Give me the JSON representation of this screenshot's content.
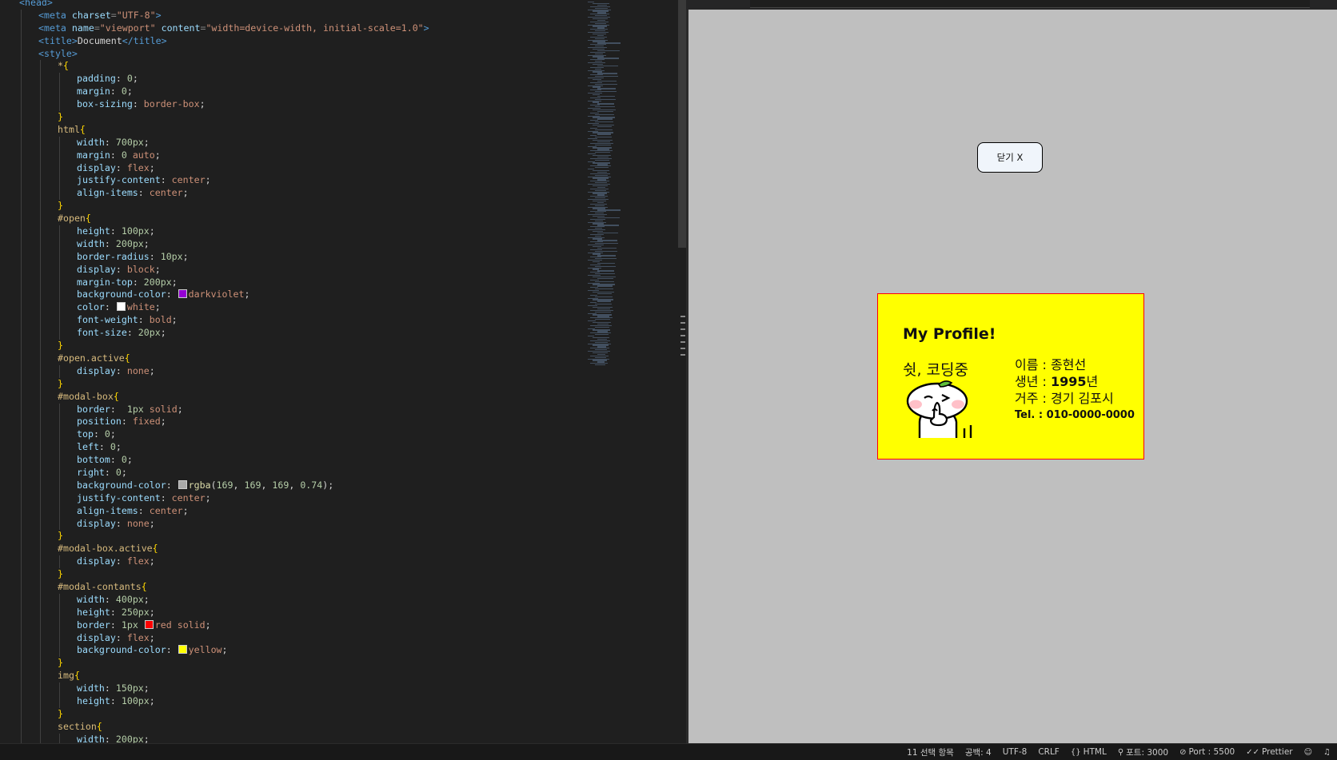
{
  "editor": {
    "lines": [
      {
        "indent": 0,
        "tokens": [
          [
            "tag",
            "<head>"
          ]
        ]
      },
      {
        "indent": 1,
        "tokens": [
          [
            "tag",
            "<meta "
          ],
          [
            "attr",
            "charset"
          ],
          [
            "punct",
            "="
          ],
          [
            "str",
            "\"UTF-8\""
          ],
          [
            "tag",
            ">"
          ]
        ]
      },
      {
        "indent": 1,
        "tokens": [
          [
            "tag",
            "<meta "
          ],
          [
            "attr",
            "name"
          ],
          [
            "punct",
            "="
          ],
          [
            "str",
            "\"viewport\""
          ],
          [
            "attr",
            " content"
          ],
          [
            "punct",
            "="
          ],
          [
            "str",
            "\"width=device-width, initial-scale=1.0\""
          ],
          [
            "tag",
            ">"
          ]
        ]
      },
      {
        "indent": 1,
        "tokens": [
          [
            "tag",
            "<title>"
          ],
          [
            "text",
            "Document"
          ],
          [
            "tag",
            "</title>"
          ]
        ]
      },
      {
        "indent": 1,
        "tokens": [
          [
            "tag",
            "<style>"
          ]
        ]
      },
      {
        "indent": 2,
        "tokens": [
          [
            "sel",
            "*"
          ],
          [
            "brace",
            "{"
          ]
        ]
      },
      {
        "indent": 3,
        "tokens": [
          [
            "prop",
            "padding"
          ],
          [
            "text",
            ": "
          ],
          [
            "num",
            "0"
          ],
          [
            "text",
            ";"
          ]
        ]
      },
      {
        "indent": 3,
        "tokens": [
          [
            "prop",
            "margin"
          ],
          [
            "text",
            ": "
          ],
          [
            "num",
            "0"
          ],
          [
            "text",
            ";"
          ]
        ]
      },
      {
        "indent": 3,
        "tokens": [
          [
            "prop",
            "box-sizing"
          ],
          [
            "text",
            ": "
          ],
          [
            "val",
            "border-box"
          ],
          [
            "text",
            ";"
          ]
        ]
      },
      {
        "indent": 2,
        "tokens": [
          [
            "brace",
            "}"
          ]
        ]
      },
      {
        "indent": 2,
        "tokens": [
          [
            "sel",
            "html"
          ],
          [
            "brace",
            "{"
          ]
        ]
      },
      {
        "indent": 3,
        "tokens": [
          [
            "prop",
            "width"
          ],
          [
            "text",
            ": "
          ],
          [
            "num",
            "700px"
          ],
          [
            "text",
            ";"
          ]
        ]
      },
      {
        "indent": 3,
        "tokens": [
          [
            "prop",
            "margin"
          ],
          [
            "text",
            ": "
          ],
          [
            "num",
            "0"
          ],
          [
            "val",
            " auto"
          ],
          [
            "text",
            ";"
          ]
        ]
      },
      {
        "indent": 3,
        "tokens": [
          [
            "prop",
            "display"
          ],
          [
            "text",
            ": "
          ],
          [
            "val",
            "flex"
          ],
          [
            "text",
            ";"
          ]
        ]
      },
      {
        "indent": 3,
        "tokens": [
          [
            "prop",
            "justify-content"
          ],
          [
            "text",
            ": "
          ],
          [
            "val",
            "center"
          ],
          [
            "text",
            ";"
          ]
        ]
      },
      {
        "indent": 3,
        "tokens": [
          [
            "prop",
            "align-items"
          ],
          [
            "text",
            ": "
          ],
          [
            "val",
            "center"
          ],
          [
            "text",
            ";"
          ]
        ]
      },
      {
        "indent": 2,
        "tokens": [
          [
            "brace",
            "}"
          ]
        ]
      },
      {
        "indent": 2,
        "tokens": [
          [
            "sel",
            "#open"
          ],
          [
            "brace",
            "{"
          ]
        ]
      },
      {
        "indent": 3,
        "tokens": [
          [
            "prop",
            "height"
          ],
          [
            "text",
            ": "
          ],
          [
            "num",
            "100px"
          ],
          [
            "text",
            ";"
          ]
        ]
      },
      {
        "indent": 3,
        "tokens": [
          [
            "prop",
            "width"
          ],
          [
            "text",
            ": "
          ],
          [
            "num",
            "200px"
          ],
          [
            "text",
            ";"
          ]
        ]
      },
      {
        "indent": 3,
        "tokens": [
          [
            "prop",
            "border-radius"
          ],
          [
            "text",
            ": "
          ],
          [
            "num",
            "10px"
          ],
          [
            "text",
            ";"
          ]
        ]
      },
      {
        "indent": 3,
        "tokens": [
          [
            "prop",
            "display"
          ],
          [
            "text",
            ": "
          ],
          [
            "val",
            "block"
          ],
          [
            "text",
            ";"
          ]
        ]
      },
      {
        "indent": 3,
        "tokens": [
          [
            "prop",
            "margin-top"
          ],
          [
            "text",
            ": "
          ],
          [
            "num",
            "200px"
          ],
          [
            "text",
            ";"
          ]
        ]
      },
      {
        "indent": 3,
        "tokens": [
          [
            "prop",
            "background-color"
          ],
          [
            "text",
            ": "
          ],
          [
            "swatch",
            "#9400d3"
          ],
          [
            "val",
            "darkviolet"
          ],
          [
            "text",
            ";"
          ]
        ]
      },
      {
        "indent": 3,
        "tokens": [
          [
            "prop",
            "color"
          ],
          [
            "text",
            ": "
          ],
          [
            "swatch",
            "#ffffff"
          ],
          [
            "val",
            "white"
          ],
          [
            "text",
            ";"
          ]
        ]
      },
      {
        "indent": 3,
        "tokens": [
          [
            "prop",
            "font-weight"
          ],
          [
            "text",
            ": "
          ],
          [
            "val",
            "bold"
          ],
          [
            "text",
            ";"
          ]
        ]
      },
      {
        "indent": 3,
        "tokens": [
          [
            "prop",
            "font-size"
          ],
          [
            "text",
            ": "
          ],
          [
            "num",
            "20px"
          ],
          [
            "text",
            ";"
          ]
        ]
      },
      {
        "indent": 2,
        "tokens": [
          [
            "brace",
            "}"
          ]
        ]
      },
      {
        "indent": 2,
        "tokens": [
          [
            "sel",
            "#open.active"
          ],
          [
            "brace",
            "{"
          ]
        ]
      },
      {
        "indent": 3,
        "tokens": [
          [
            "prop",
            "display"
          ],
          [
            "text",
            ": "
          ],
          [
            "val",
            "none"
          ],
          [
            "text",
            ";"
          ]
        ]
      },
      {
        "indent": 2,
        "tokens": [
          [
            "brace",
            "}"
          ]
        ]
      },
      {
        "indent": 2,
        "tokens": [
          [
            "sel",
            "#modal-box"
          ],
          [
            "brace",
            "{"
          ]
        ]
      },
      {
        "indent": 3,
        "tokens": [
          [
            "prop",
            "border"
          ],
          [
            "text",
            ":  "
          ],
          [
            "num",
            "1px"
          ],
          [
            "val",
            " solid"
          ],
          [
            "text",
            ";"
          ]
        ]
      },
      {
        "indent": 3,
        "tokens": [
          [
            "prop",
            "position"
          ],
          [
            "text",
            ": "
          ],
          [
            "val",
            "fixed"
          ],
          [
            "text",
            ";"
          ]
        ]
      },
      {
        "indent": 3,
        "tokens": [
          [
            "prop",
            "top"
          ],
          [
            "text",
            ": "
          ],
          [
            "num",
            "0"
          ],
          [
            "text",
            ";"
          ]
        ]
      },
      {
        "indent": 3,
        "tokens": [
          [
            "prop",
            "left"
          ],
          [
            "text",
            ": "
          ],
          [
            "num",
            "0"
          ],
          [
            "text",
            ";"
          ]
        ]
      },
      {
        "indent": 3,
        "tokens": [
          [
            "prop",
            "bottom"
          ],
          [
            "text",
            ": "
          ],
          [
            "num",
            "0"
          ],
          [
            "text",
            ";"
          ]
        ]
      },
      {
        "indent": 3,
        "tokens": [
          [
            "prop",
            "right"
          ],
          [
            "text",
            ": "
          ],
          [
            "num",
            "0"
          ],
          [
            "text",
            ";"
          ]
        ]
      },
      {
        "indent": 3,
        "tokens": [
          [
            "prop",
            "background-color"
          ],
          [
            "text",
            ": "
          ],
          [
            "swatch",
            "#a9a9a9"
          ],
          [
            "fn",
            "rgba"
          ],
          [
            "text",
            "("
          ],
          [
            "num",
            "169"
          ],
          [
            "text",
            ", "
          ],
          [
            "num",
            "169"
          ],
          [
            "text",
            ", "
          ],
          [
            "num",
            "169"
          ],
          [
            "text",
            ", "
          ],
          [
            "num",
            "0.74"
          ],
          [
            "text",
            ");"
          ]
        ]
      },
      {
        "indent": 3,
        "tokens": [
          [
            "prop",
            "justify-content"
          ],
          [
            "text",
            ": "
          ],
          [
            "val",
            "center"
          ],
          [
            "text",
            ";"
          ]
        ]
      },
      {
        "indent": 3,
        "tokens": [
          [
            "prop",
            "align-items"
          ],
          [
            "text",
            ": "
          ],
          [
            "val",
            "center"
          ],
          [
            "text",
            ";"
          ]
        ]
      },
      {
        "indent": 3,
        "tokens": [
          [
            "prop",
            "display"
          ],
          [
            "text",
            ": "
          ],
          [
            "val",
            "none"
          ],
          [
            "text",
            ";"
          ]
        ]
      },
      {
        "indent": 2,
        "tokens": [
          [
            "brace",
            "}"
          ]
        ]
      },
      {
        "indent": 2,
        "tokens": [
          [
            "sel",
            "#modal-box.active"
          ],
          [
            "brace",
            "{"
          ]
        ]
      },
      {
        "indent": 3,
        "tokens": [
          [
            "prop",
            "display"
          ],
          [
            "text",
            ": "
          ],
          [
            "val",
            "flex"
          ],
          [
            "text",
            ";"
          ]
        ]
      },
      {
        "indent": 2,
        "tokens": [
          [
            "brace",
            "}"
          ]
        ]
      },
      {
        "indent": 2,
        "tokens": [
          [
            "sel",
            "#modal-contants"
          ],
          [
            "brace",
            "{"
          ]
        ]
      },
      {
        "indent": 3,
        "tokens": [
          [
            "prop",
            "width"
          ],
          [
            "text",
            ": "
          ],
          [
            "num",
            "400px"
          ],
          [
            "text",
            ";"
          ]
        ]
      },
      {
        "indent": 3,
        "tokens": [
          [
            "prop",
            "height"
          ],
          [
            "text",
            ": "
          ],
          [
            "num",
            "250px"
          ],
          [
            "text",
            ";"
          ]
        ]
      },
      {
        "indent": 3,
        "tokens": [
          [
            "prop",
            "border"
          ],
          [
            "text",
            ": "
          ],
          [
            "num",
            "1px"
          ],
          [
            "text",
            " "
          ],
          [
            "swatch",
            "#ff0000"
          ],
          [
            "val",
            "red solid"
          ],
          [
            "text",
            ";"
          ]
        ]
      },
      {
        "indent": 3,
        "tokens": [
          [
            "prop",
            "display"
          ],
          [
            "text",
            ": "
          ],
          [
            "val",
            "flex"
          ],
          [
            "text",
            ";"
          ]
        ]
      },
      {
        "indent": 3,
        "tokens": [
          [
            "prop",
            "background-color"
          ],
          [
            "text",
            ": "
          ],
          [
            "swatch",
            "#ffff00"
          ],
          [
            "val",
            "yellow"
          ],
          [
            "text",
            ";"
          ]
        ]
      },
      {
        "indent": 2,
        "tokens": [
          [
            "brace",
            "}"
          ]
        ]
      },
      {
        "indent": 2,
        "tokens": [
          [
            "sel",
            "img"
          ],
          [
            "brace",
            "{"
          ]
        ]
      },
      {
        "indent": 3,
        "tokens": [
          [
            "prop",
            "width"
          ],
          [
            "text",
            ": "
          ],
          [
            "num",
            "150px"
          ],
          [
            "text",
            ";"
          ]
        ]
      },
      {
        "indent": 3,
        "tokens": [
          [
            "prop",
            "height"
          ],
          [
            "text",
            ": "
          ],
          [
            "num",
            "100px"
          ],
          [
            "text",
            ";"
          ]
        ]
      },
      {
        "indent": 2,
        "tokens": [
          [
            "brace",
            "}"
          ]
        ]
      },
      {
        "indent": 2,
        "tokens": [
          [
            "sel",
            "section"
          ],
          [
            "brace",
            "{"
          ]
        ]
      },
      {
        "indent": 3,
        "tokens": [
          [
            "prop",
            "width"
          ],
          [
            "text",
            ": "
          ],
          [
            "num",
            "200px"
          ],
          [
            "text",
            ";"
          ]
        ]
      },
      {
        "indent": 2,
        "tokens": [
          [
            "brace",
            "}"
          ]
        ]
      }
    ]
  },
  "preview": {
    "close_button": "닫기 X",
    "profile_title": "My Profile!",
    "caption": "쉿, 코딩중",
    "character_icon": "finger-on-lips-character-icon",
    "info": {
      "name": "이름 : 종현선",
      "birth_label": "생년 : ",
      "birth_year": "1995",
      "birth_suffix": "년",
      "residence": "거주 : 경기 김포시",
      "tel": "Tel. : 010-0000-0000"
    },
    "colors": {
      "page_background": "#bfbfbf",
      "card_background": "#ffff00",
      "card_border": "#ff0000",
      "button_background": "#f0f5fb"
    }
  },
  "statusbar": {
    "selection": "11 선택 항목",
    "indent": "공백: 4",
    "encoding": "UTF-8",
    "eol": "CRLF",
    "language": "HTML",
    "port_info": "포트: 3000",
    "live_server": "Port : 5500",
    "prettier": "Prettier"
  }
}
